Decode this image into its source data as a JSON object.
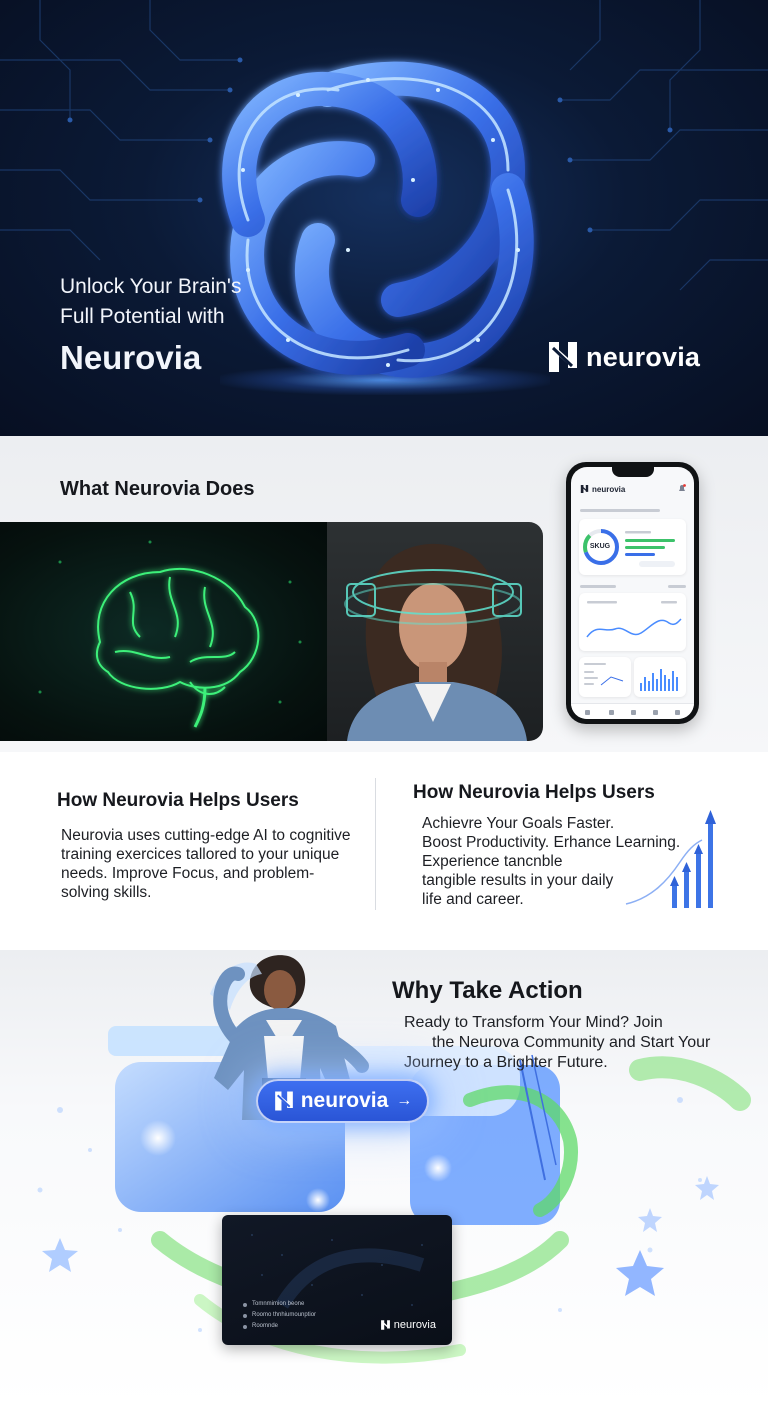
{
  "hero": {
    "title_line1": "Unlock Your Brain's",
    "title_line2": "Full Potential with",
    "brand": "Neurovia",
    "logo_text": "neurovia",
    "colors": {
      "background": "#0b1a36",
      "knot": "#3f7bff",
      "glow": "#5aa0ff"
    }
  },
  "what": {
    "title": "What Neurovia Does",
    "phone": {
      "brand": "neurovia",
      "gauge_label": "SKUG"
    }
  },
  "how": {
    "left": {
      "title": "How Neurovia Helps Users",
      "body": "Neurovia uses cutting-edge AI to cognitive training exercices tallored to your unique needs. Improve Focus, and problem-solving skills."
    },
    "right": {
      "title": "How Neurovia Helps Users",
      "lines": [
        "Achievre Your Goals Faster.",
        "Boost Productivity. Erhance Learning.",
        "Experience tancnble",
        "tangible results in your daily",
        "life and career."
      ]
    }
  },
  "action": {
    "title": "Why Take Action",
    "lines": [
      "Ready to Transform Your Mind? Join",
      "the Neurova Community and Start Your",
      "Journey to a Brighter Future."
    ],
    "cta": {
      "label": "neurovia",
      "arrow": "→"
    },
    "promo": {
      "items": [
        "Tomnmimion beone",
        "Roomo thnhiumounptior",
        "Roomnde"
      ],
      "logo_text": "neurovia"
    },
    "colors": {
      "cta": "#2f5fe0",
      "accent_green": "#6ee06a",
      "accent_blue": "#4a8cff"
    }
  }
}
